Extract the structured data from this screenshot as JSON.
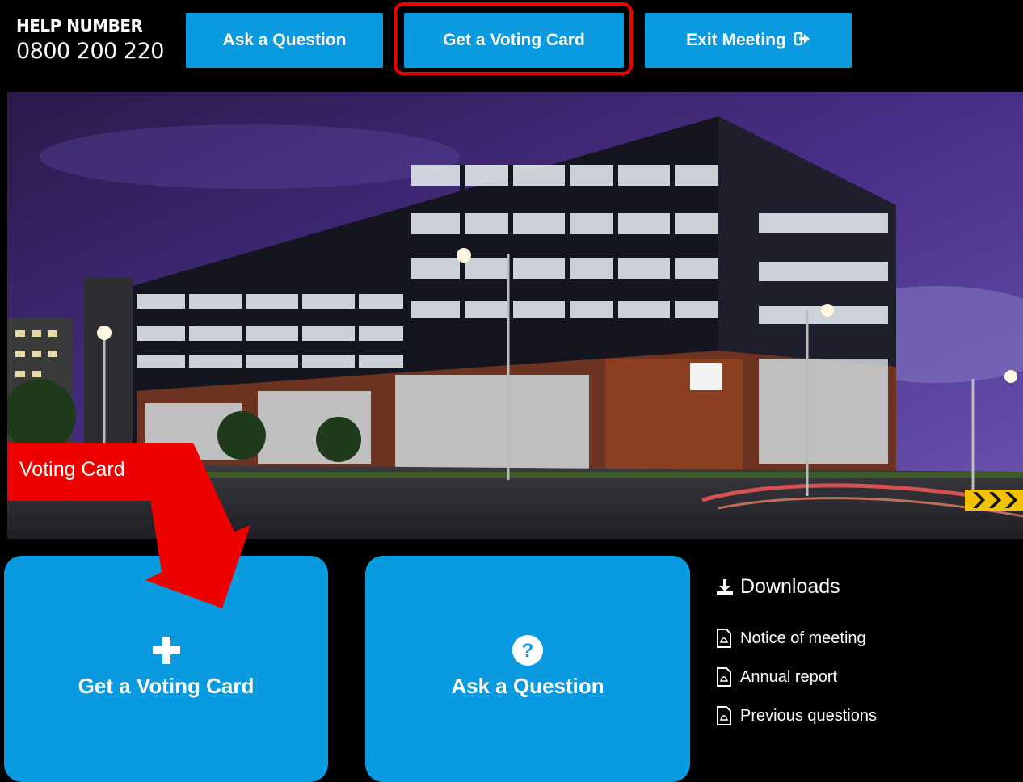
{
  "help": {
    "label": "HELP NUMBER",
    "number": "0800 200 220"
  },
  "header": {
    "ask_label": "Ask a Question",
    "voting_label": "Get a Voting Card",
    "exit_label": "Exit Meeting",
    "exit_icon": "sign-out-icon"
  },
  "tiles": [
    {
      "label": "Get a Voting Card",
      "icon": "plus-icon"
    },
    {
      "label": "Ask a Question",
      "icon": "question-circle-icon"
    }
  ],
  "downloads": {
    "title": "Downloads",
    "title_icon": "download-icon",
    "items": [
      {
        "label": "Notice of meeting",
        "icon": "pdf-file-icon"
      },
      {
        "label": "Annual report",
        "icon": "pdf-file-icon"
      },
      {
        "label": "Previous questions",
        "icon": "pdf-file-icon"
      }
    ]
  },
  "annotation": {
    "label": "Voting Card"
  },
  "colors": {
    "accent": "#0a9ae0",
    "highlight": "#e00000",
    "background": "#000000"
  }
}
